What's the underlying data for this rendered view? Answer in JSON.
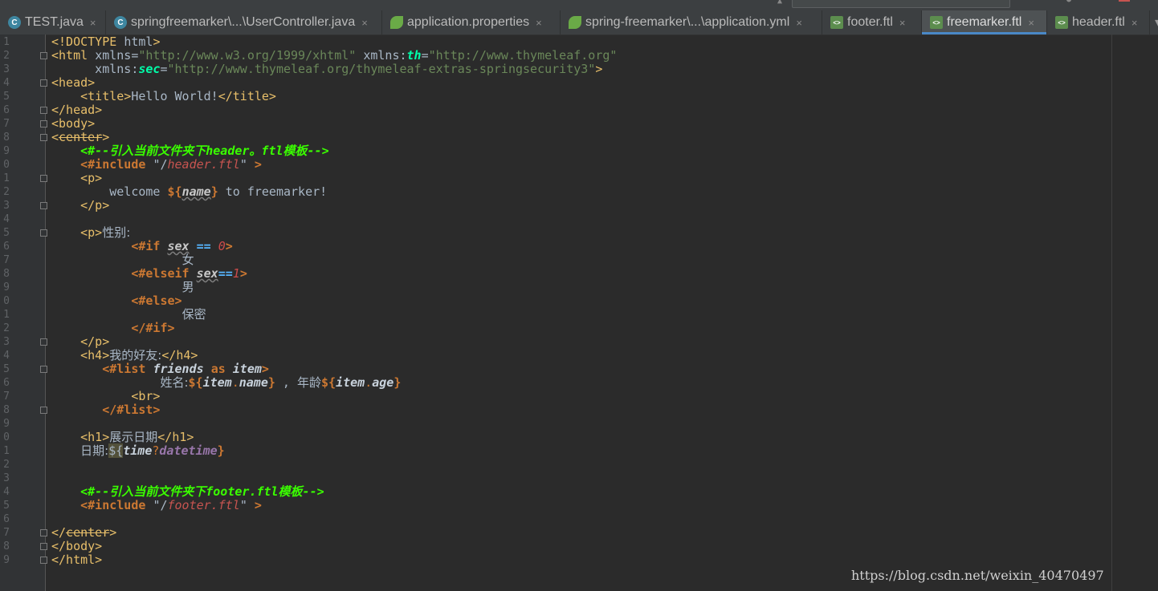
{
  "tabs": [
    {
      "label": "TEST.java",
      "icon": "java-class-icon",
      "active": false
    },
    {
      "label": "springfreemarker\\...\\UserController.java",
      "icon": "java-class-icon",
      "active": false
    },
    {
      "label": "application.properties",
      "icon": "spring-leaf-icon",
      "active": false
    },
    {
      "label": "spring-freemarker\\...\\application.yml",
      "icon": "spring-leaf-icon",
      "active": false
    },
    {
      "label": "footer.ftl",
      "icon": "ftl-file-icon",
      "active": false
    },
    {
      "label": "freemarker.ftl",
      "icon": "ftl-file-icon",
      "active": true
    },
    {
      "label": "header.ftl",
      "icon": "ftl-file-icon",
      "active": false
    }
  ],
  "tab_close_glyph": "×",
  "tab_overflow_glyph": "▾",
  "line_numbers": [
    "1",
    "2",
    "3",
    "4",
    "5",
    "6",
    "7",
    "8",
    "9",
    "0",
    "1",
    "2",
    "3",
    "4",
    "5",
    "6",
    "7",
    "8",
    "9",
    "0",
    "1",
    "2",
    "3",
    "4",
    "5",
    "6",
    "7",
    "8",
    "9",
    "0",
    "1",
    "2",
    "3",
    "4",
    "5",
    "6",
    "7",
    "8",
    "9"
  ],
  "code_lines": [
    [
      [
        "t",
        "<!DOCTYPE "
      ],
      [
        "",
        "html"
      ],
      [
        "t",
        ">"
      ]
    ],
    [
      [
        "t",
        "<html "
      ],
      [
        "",
        "xmlns="
      ],
      [
        "av",
        "\"http://www.w3.org/1999/xhtml\""
      ],
      [
        "",
        " xmlns:"
      ],
      [
        "ns2",
        "th"
      ],
      [
        "",
        "="
      ],
      [
        "av",
        "\"http://www.thymeleaf.org\""
      ]
    ],
    [
      [
        "",
        "      xmlns:"
      ],
      [
        "ns2",
        "sec"
      ],
      [
        "",
        "="
      ],
      [
        "av",
        "\"http://www.thymeleaf.org/thymeleaf-extras-springsecurity3\""
      ],
      [
        "t",
        ">"
      ]
    ],
    [
      [
        "t",
        "<head>"
      ]
    ],
    [
      [
        "",
        "    "
      ],
      [
        "t",
        "<title>"
      ],
      [
        "",
        "Hello World!"
      ],
      [
        "t",
        "</title>"
      ]
    ],
    [
      [
        "t",
        "</head>"
      ]
    ],
    [
      [
        "t",
        "<body>"
      ]
    ],
    [
      [
        "t",
        "<"
      ],
      [
        "strk",
        "center"
      ],
      [
        "t",
        ">"
      ]
    ],
    [
      [
        "",
        "    "
      ],
      [
        "ct",
        "<#--引入当前文件夹下header。ftl模板-->"
      ]
    ],
    [
      [
        "",
        "    "
      ],
      [
        "ft",
        "<#include "
      ],
      [
        "",
        "\"/"
      ],
      [
        "str",
        "header.ftl"
      ],
      [
        "",
        "\" "
      ],
      [
        "ft",
        ">"
      ]
    ],
    [
      [
        "",
        "    "
      ],
      [
        "t",
        "<p>"
      ]
    ],
    [
      [
        "",
        "        welcome "
      ],
      [
        "ft",
        "${"
      ],
      [
        "pv",
        "name"
      ],
      [
        "ft",
        "}"
      ],
      [
        "",
        " to freemarker!"
      ]
    ],
    [
      [
        "",
        "    "
      ],
      [
        "t",
        "</p>"
      ]
    ],
    [],
    [
      [
        "",
        "    "
      ],
      [
        "t",
        "<p>"
      ],
      [
        "cjk",
        "性别:"
      ]
    ],
    [
      [
        "",
        "           "
      ],
      [
        "ft",
        "<#if "
      ],
      [
        "pv",
        "sex"
      ],
      [
        "",
        " "
      ],
      [
        "op",
        "=="
      ],
      [
        "",
        " "
      ],
      [
        "num",
        "0"
      ],
      [
        "ft",
        ">"
      ]
    ],
    [
      [
        "",
        "                  "
      ],
      [
        "cjk",
        "女"
      ]
    ],
    [
      [
        "",
        "           "
      ],
      [
        "ft",
        "<#elseif "
      ],
      [
        "pv",
        "sex"
      ],
      [
        "op",
        "=="
      ],
      [
        "num",
        "1"
      ],
      [
        "ft",
        ">"
      ]
    ],
    [
      [
        "",
        "                  "
      ],
      [
        "cjk",
        "男"
      ]
    ],
    [
      [
        "",
        "           "
      ],
      [
        "ft",
        "<#else>"
      ]
    ],
    [
      [
        "",
        "                  "
      ],
      [
        "cjk",
        "保密"
      ]
    ],
    [
      [
        "",
        "           "
      ],
      [
        "ft",
        "</#if>"
      ]
    ],
    [
      [
        "",
        "    "
      ],
      [
        "t",
        "</p>"
      ]
    ],
    [
      [
        "",
        "    "
      ],
      [
        "t",
        "<h4>"
      ],
      [
        "cjk",
        "我的好友:"
      ],
      [
        "t",
        "</h4>"
      ]
    ],
    [
      [
        "",
        "       "
      ],
      [
        "ft",
        "<#list "
      ],
      [
        "iname",
        "friends"
      ],
      [
        "",
        " "
      ],
      [
        "ft",
        "as "
      ],
      [
        "iname",
        "item"
      ],
      [
        "ft",
        ">"
      ]
    ],
    [
      [
        "",
        "               "
      ],
      [
        "cjk",
        "姓名:"
      ],
      [
        "ft",
        "${"
      ],
      [
        "iname",
        "item"
      ],
      [
        "dot",
        "."
      ],
      [
        "iname",
        "name"
      ],
      [
        "ft",
        "}"
      ],
      [
        "",
        " , "
      ],
      [
        "cjk",
        "年龄"
      ],
      [
        "ft",
        "${"
      ],
      [
        "iname",
        "item"
      ],
      [
        "dot",
        "."
      ],
      [
        "iname",
        "age"
      ],
      [
        "ft",
        "}"
      ]
    ],
    [
      [
        "",
        "           "
      ],
      [
        "t",
        "<br>"
      ]
    ],
    [
      [
        "",
        "       "
      ],
      [
        "ft",
        "</#list>"
      ]
    ],
    [],
    [
      [
        "",
        "    "
      ],
      [
        "t",
        "<h1>"
      ],
      [
        "cjk",
        "展示日期"
      ],
      [
        "t",
        "</h1>"
      ]
    ],
    [
      [
        "",
        "    "
      ],
      [
        "cjk",
        "日期:"
      ],
      [
        "hl",
        "${"
      ],
      [
        "iname",
        "time"
      ],
      [
        "dot",
        "?"
      ],
      [
        "iv",
        "datetime"
      ],
      [
        "ft",
        "}"
      ]
    ],
    [],
    [],
    [
      [
        "",
        "    "
      ],
      [
        "ct",
        "<#--引入当前文件夹下footer.ftl模板-->"
      ]
    ],
    [
      [
        "",
        "    "
      ],
      [
        "ft",
        "<#include "
      ],
      [
        "",
        "\"/"
      ],
      [
        "str",
        "footer.ftl"
      ],
      [
        "",
        "\" "
      ],
      [
        "ft",
        ">"
      ]
    ],
    [],
    [
      [
        "t",
        "</"
      ],
      [
        "strk",
        "center"
      ],
      [
        "t",
        ">"
      ]
    ],
    [
      [
        "t",
        "</body>"
      ]
    ],
    [
      [
        "t",
        "</html>"
      ]
    ]
  ],
  "watermark": "https://blog.csdn.net/weixin_40470497",
  "colors": {
    "editor_bg": "#2b2b2b",
    "gutter_bg": "#313335",
    "active_tab_accent": "#4a88c7",
    "comment_green": "#3aff00",
    "ftl_orange": "#cc7832"
  }
}
